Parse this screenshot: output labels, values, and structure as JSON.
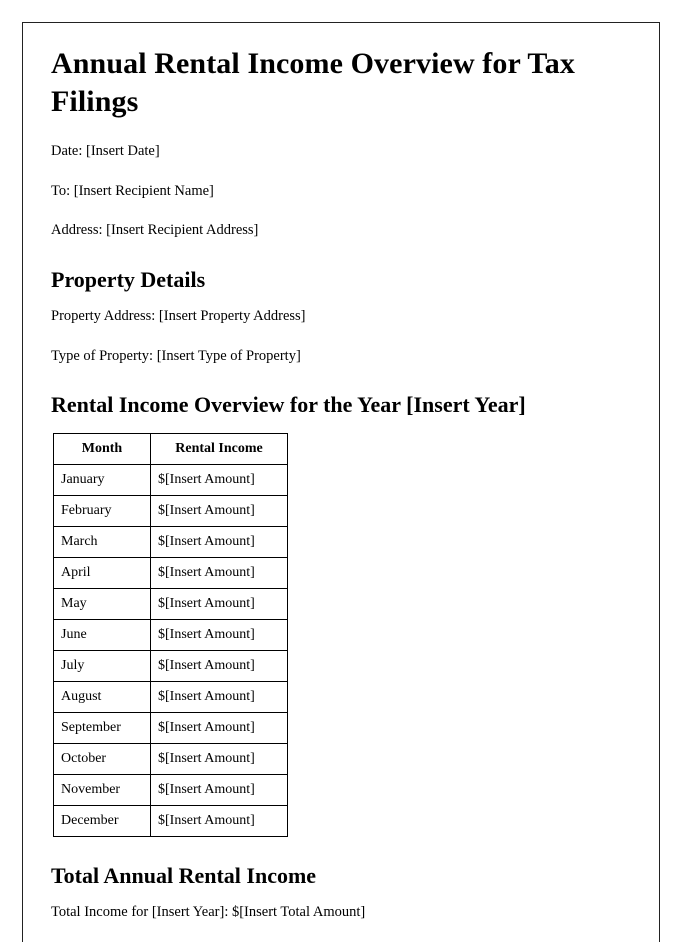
{
  "document": {
    "title": "Annual Rental Income Overview for Tax Filings",
    "meta": {
      "date_line": "Date: [Insert Date]",
      "to_line": "To: [Insert Recipient Name]",
      "address_line": "Address: [Insert Recipient Address]"
    },
    "property_details": {
      "heading": "Property Details",
      "property_address_line": "Property Address: [Insert Property Address]",
      "type_of_property_line": "Type of Property: [Insert Type of Property]"
    },
    "rental_income_overview": {
      "heading": "Rental Income Overview for the Year [Insert Year]",
      "table": {
        "columns": [
          "Month",
          "Rental Income"
        ],
        "rows": [
          {
            "month": "January",
            "income": "$[Insert Amount]"
          },
          {
            "month": "February",
            "income": "$[Insert Amount]"
          },
          {
            "month": "March",
            "income": "$[Insert Amount]"
          },
          {
            "month": "April",
            "income": "$[Insert Amount]"
          },
          {
            "month": "May",
            "income": "$[Insert Amount]"
          },
          {
            "month": "June",
            "income": "$[Insert Amount]"
          },
          {
            "month": "July",
            "income": "$[Insert Amount]"
          },
          {
            "month": "August",
            "income": "$[Insert Amount]"
          },
          {
            "month": "September",
            "income": "$[Insert Amount]"
          },
          {
            "month": "October",
            "income": "$[Insert Amount]"
          },
          {
            "month": "November",
            "income": "$[Insert Amount]"
          },
          {
            "month": "December",
            "income": "$[Insert Amount]"
          }
        ]
      }
    },
    "total_annual_rental_income": {
      "heading": "Total Annual Rental Income",
      "total_line": "Total Income for [Insert Year]: $[Insert Total Amount]"
    }
  },
  "colors": {
    "text": "#000000",
    "page_border": "#222222",
    "table_border": "#000000",
    "background": "#ffffff"
  }
}
